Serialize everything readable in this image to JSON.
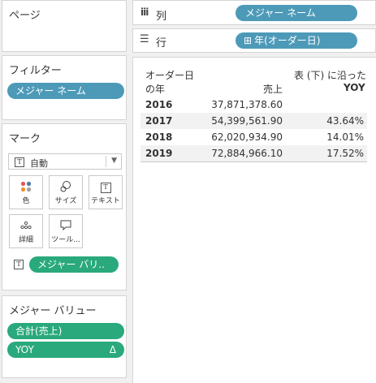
{
  "pages_card": {
    "title": "ページ"
  },
  "filters_card": {
    "title": "フィルター",
    "pills": [
      "メジャー ネーム"
    ]
  },
  "marks_card": {
    "title": "マーク",
    "mark_type": "自動",
    "mark_type_icon": "T",
    "buttons": [
      {
        "label": "色",
        "icon": "color-dots-icon"
      },
      {
        "label": "サイズ",
        "icon": "size-icon"
      },
      {
        "label": "テキスト",
        "icon": "text-icon",
        "glyph": "T"
      },
      {
        "label": "詳細",
        "icon": "detail-dots-icon"
      },
      {
        "label": "ツール...",
        "icon": "tooltip-icon"
      }
    ],
    "field_icon": "T",
    "field_pill": "メジャー バリ.."
  },
  "measure_values_card": {
    "title": "メジャー バリュー",
    "pills": [
      {
        "label": "合計(売上)",
        "suffix": ""
      },
      {
        "label": "YOY",
        "suffix": "Δ"
      }
    ]
  },
  "shelves": {
    "columns": {
      "label": "列",
      "icon": "iii",
      "pill": "メジャー ネーム"
    },
    "rows": {
      "label": "行",
      "icon": "☰",
      "pill": "年(オーダー日)",
      "pill_icon": "⊞"
    }
  },
  "view": {
    "header": {
      "col1_line1": "オーダー日",
      "col1_line2": "の年",
      "col2": "売上",
      "col3_line1": "表 (下) に沿った",
      "col3_line2": "YOY"
    },
    "rows": [
      {
        "year": "2016",
        "sales": "37,871,378.60",
        "yoy": ""
      },
      {
        "year": "2017",
        "sales": "54,399,561.90",
        "yoy": "43.64%"
      },
      {
        "year": "2018",
        "sales": "62,020,934.90",
        "yoy": "14.01%"
      },
      {
        "year": "2019",
        "sales": "72,884,966.10",
        "yoy": "17.52%"
      }
    ]
  },
  "colors": {
    "blue_pill": "#4d9ab8",
    "green_pill": "#2aa97c",
    "panel_border": "#d4d4d4",
    "row_band": "#f2f2f2"
  }
}
